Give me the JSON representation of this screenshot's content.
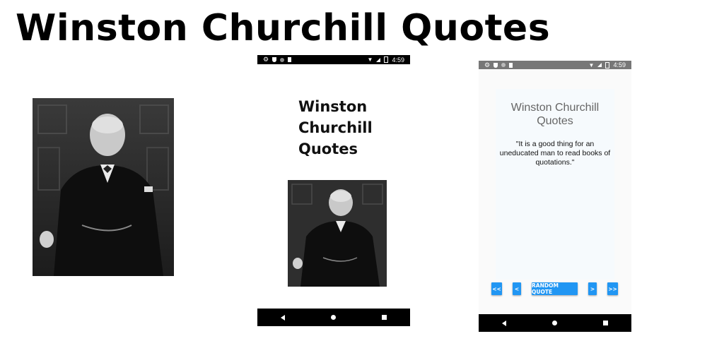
{
  "banner": {
    "title": "Winston Churchill Quotes"
  },
  "phone1": {
    "status": {
      "time": "4:59"
    },
    "title_lines": [
      "Winston",
      "Churchill",
      "Quotes"
    ]
  },
  "phone2": {
    "status": {
      "time": "4:59"
    },
    "title_lines": [
      "Winston Churchill",
      "Quotes"
    ],
    "quote": "\"It is a good thing for an uneducated man to read books of quotations.\"",
    "buttons": {
      "first": "<<",
      "prev": "<",
      "random": "RANDOM QUOTE",
      "next": ">",
      "last": ">>"
    }
  },
  "icons": {
    "status_left": [
      "gear-icon",
      "shield-icon",
      "circle-icon",
      "sd-card-icon"
    ],
    "status_right": [
      "wifi-icon",
      "signal-icon",
      "battery-icon"
    ],
    "nav": [
      "back-icon",
      "home-icon",
      "recents-icon"
    ]
  }
}
